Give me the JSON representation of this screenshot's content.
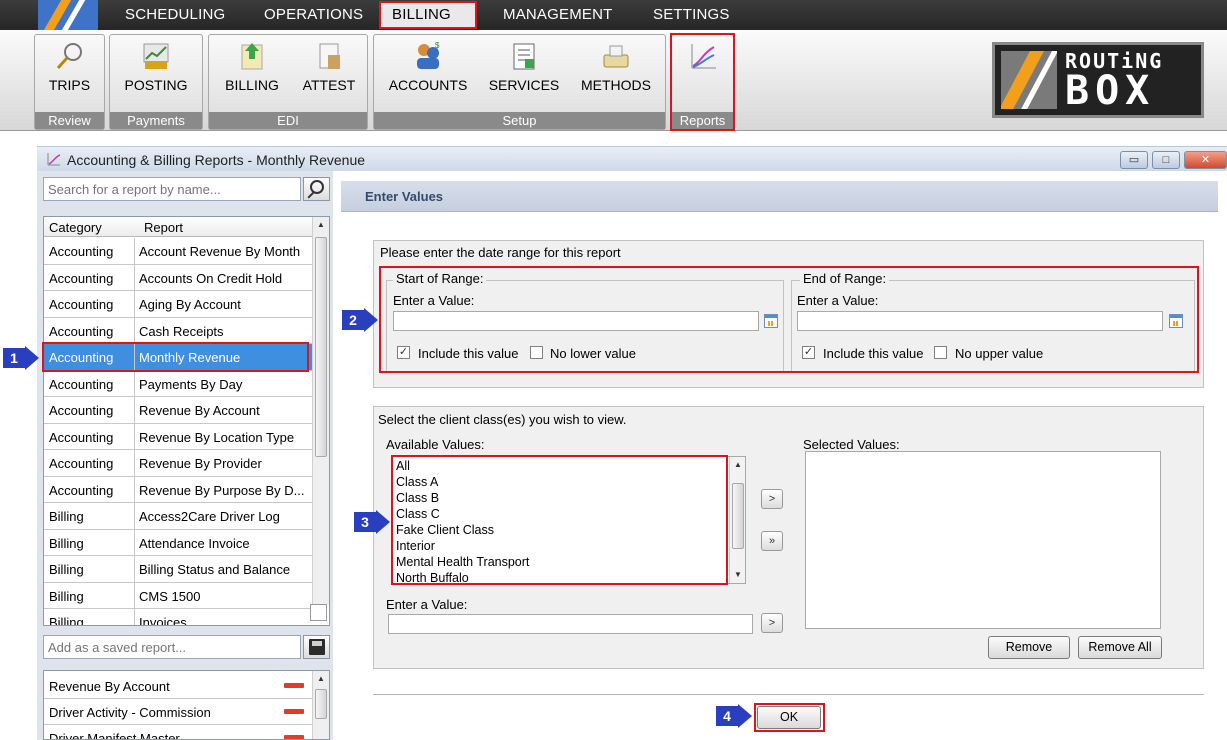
{
  "menu": {
    "items": [
      "SCHEDULING",
      "OPERATIONS",
      "BILLING",
      "MANAGEMENT",
      "SETTINGS"
    ],
    "active": "BILLING"
  },
  "ribbon": {
    "groups": [
      {
        "label": "Review",
        "buttons": [
          "TRIPS"
        ]
      },
      {
        "label": "Payments",
        "buttons": [
          "POSTING"
        ]
      },
      {
        "label": "EDI",
        "buttons": [
          "BILLING",
          "ATTEST"
        ]
      },
      {
        "label": "Setup",
        "buttons": [
          "ACCOUNTS",
          "SERVICES",
          "METHODS"
        ]
      },
      {
        "label": "Reports",
        "buttons": [
          ""
        ]
      }
    ],
    "brand_top": "ROUTiNG",
    "brand_bottom": "BOX"
  },
  "window": {
    "title": "Accounting & Billing Reports - Monthly Revenue"
  },
  "left": {
    "search_placeholder": "Search for a report by name...",
    "columns": [
      "Category",
      "Report"
    ],
    "rows": [
      {
        "category": "Accounting",
        "report": "Account Revenue By Month"
      },
      {
        "category": "Accounting",
        "report": "Accounts On Credit Hold"
      },
      {
        "category": "Accounting",
        "report": "Aging By Account"
      },
      {
        "category": "Accounting",
        "report": "Cash Receipts"
      },
      {
        "category": "Accounting",
        "report": "Monthly Revenue"
      },
      {
        "category": "Accounting",
        "report": "Payments By Day"
      },
      {
        "category": "Accounting",
        "report": "Revenue By Account"
      },
      {
        "category": "Accounting",
        "report": "Revenue By Location Type"
      },
      {
        "category": "Accounting",
        "report": "Revenue By Provider"
      },
      {
        "category": "Accounting",
        "report": "Revenue By Purpose By D..."
      },
      {
        "category": "Billing",
        "report": "Access2Care Driver Log"
      },
      {
        "category": "Billing",
        "report": "Attendance Invoice"
      },
      {
        "category": "Billing",
        "report": "Billing Status and Balance"
      },
      {
        "category": "Billing",
        "report": "CMS 1500"
      },
      {
        "category": "Billing",
        "report": "Invoices"
      }
    ],
    "selected_index": 4,
    "saved_placeholder": "Add as a saved report...",
    "saved": [
      "Revenue By Account",
      "Driver Activity - Commission",
      "Driver Manifest Master"
    ]
  },
  "right": {
    "header": "Enter Values",
    "date_prompt": "Please enter the date range for this report",
    "start_legend": "Start of Range:",
    "end_legend": "End of Range:",
    "enter_value": "Enter a Value:",
    "start_value": "",
    "end_value": "",
    "include_label": "Include this value",
    "no_lower": "No lower value",
    "no_upper": "No upper value",
    "class_prompt": "Select the client class(es) you wish to view.",
    "available_label": "Available Values:",
    "selected_label": "Selected Values:",
    "available_values": [
      "All",
      "Class A",
      "Class B",
      "Class C",
      "Fake Client Class",
      "Interior",
      "Mental Health Transport",
      "North Buffalo"
    ],
    "enter_value_2": "Enter a Value:",
    "enter_value_2_value": "",
    "move_one": ">",
    "move_all": "»",
    "add_one": ">",
    "remove": "Remove",
    "remove_all": "Remove All",
    "ok": "OK"
  },
  "markers": [
    "1",
    "2",
    "3",
    "4"
  ],
  "colors": {
    "highlight_red": "#e0131a",
    "marker_blue": "#2a3fbf",
    "selection_blue": "#3f8fe0"
  }
}
